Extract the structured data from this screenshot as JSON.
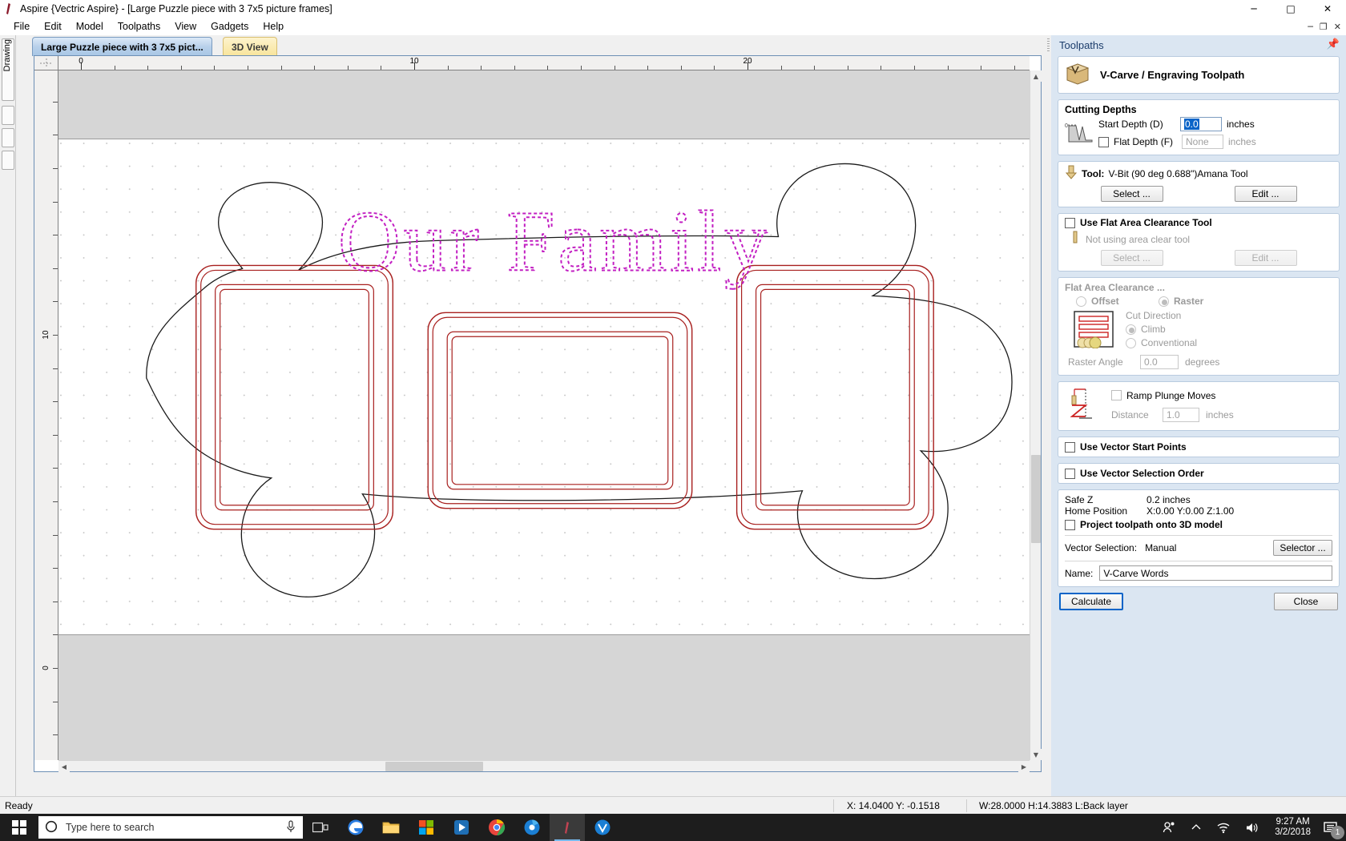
{
  "window": {
    "title": "Aspire {Vectric Aspire} - [Large Puzzle piece with 3 7x5 picture frames]",
    "minimize": "─",
    "maximize": "□",
    "close": "✕",
    "doc_minimize": "─",
    "doc_restore": "❐",
    "doc_close": "✕"
  },
  "menu": {
    "items": [
      "File",
      "Edit",
      "Model",
      "Toolpaths",
      "View",
      "Gadgets",
      "Help"
    ]
  },
  "left_dock": {
    "label": "Drawing"
  },
  "tabs": [
    {
      "label": "Large Puzzle piece with 3 7x5 pict...",
      "active": true
    },
    {
      "label": "3D View",
      "active": false
    }
  ],
  "rulers": {
    "horizontal_labels": [
      "0",
      "10",
      "20"
    ],
    "vertical_labels": [
      "10",
      "0"
    ]
  },
  "canvas": {
    "artwork_text": "Our Family"
  },
  "toolpaths": {
    "panel_title": "Toolpaths",
    "pin_icon": "pin-icon",
    "header": "V-Carve / Engraving Toolpath",
    "cutting_depths": {
      "title": "Cutting Depths",
      "start_depth_label": "Start Depth (D)",
      "start_depth_value": "0.0",
      "start_depth_units": "inches",
      "flat_depth_label": "Flat Depth (F)",
      "flat_depth_checked": false,
      "flat_depth_value": "None",
      "flat_depth_units": "inches"
    },
    "tool": {
      "label": "Tool:",
      "value": "V-Bit (90 deg 0.688\")Amana Tool",
      "select_button": "Select ...",
      "edit_button": "Edit ..."
    },
    "area_clearance_tool": {
      "checkbox_label": "Use Flat Area Clearance Tool",
      "checked": false,
      "status": "Not using area clear tool",
      "select_button": "Select ...",
      "edit_button": "Edit ..."
    },
    "flat_area_clearance": {
      "title": "Flat Area Clearance ...",
      "offset_label": "Offset",
      "raster_label": "Raster",
      "strategy_selected": "Raster",
      "cut_direction_label": "Cut Direction",
      "climb_label": "Climb",
      "conventional_label": "Conventional",
      "cut_direction_selected": "Climb",
      "raster_angle_label": "Raster Angle",
      "raster_angle_value": "0.0",
      "raster_angle_units": "degrees"
    },
    "ramp": {
      "checkbox_label": "Ramp Plunge Moves",
      "checked": false,
      "distance_label": "Distance",
      "distance_value": "1.0",
      "distance_units": "inches"
    },
    "vector_start_points": {
      "label": "Use Vector Start Points",
      "checked": false
    },
    "vector_selection_order": {
      "label": "Use Vector Selection Order",
      "checked": false
    },
    "position": {
      "safe_z_label": "Safe Z",
      "safe_z_value": "0.2 inches",
      "home_position_label": "Home Position",
      "home_position_value": "X:0.00 Y:0.00 Z:1.00",
      "project_label": "Project toolpath onto 3D model",
      "project_checked": false,
      "vector_selection_label": "Vector Selection:",
      "vector_selection_value": "Manual",
      "selector_button": "Selector ...",
      "name_label": "Name:",
      "name_value": "V-Carve Words"
    },
    "calculate_button": "Calculate",
    "close_button": "Close"
  },
  "statusbar": {
    "ready": "Ready",
    "coords": "X: 14.0400 Y: -0.1518",
    "dimensions": "W:28.0000   H:14.3883   L:Back layer"
  },
  "taskbar": {
    "start_icon": "windows-start-icon",
    "search_placeholder": "Type here to search",
    "search_icon": "search-circle-icon",
    "mic_icon": "microphone-icon",
    "items": [
      {
        "name": "task-view-icon"
      },
      {
        "name": "edge-browser-icon"
      },
      {
        "name": "file-explorer-icon"
      },
      {
        "name": "microsoft-store-icon"
      },
      {
        "name": "media-player-icon"
      },
      {
        "name": "chrome-browser-icon"
      },
      {
        "name": "photo-viewer-icon"
      },
      {
        "name": "aspire-app-icon"
      },
      {
        "name": "vcarve-app-icon"
      }
    ],
    "tray": {
      "people_icon": "people-icon",
      "chevron_icon": "chevron-up-icon",
      "wifi_icon": "wifi-icon",
      "volume_icon": "speaker-icon",
      "time": "9:27 AM",
      "date": "3/2/2018",
      "notification_icon": "notification-icon",
      "notification_count": "1"
    }
  },
  "colors": {
    "accent": "#0a64c8",
    "panel_bg": "#dbe6f2",
    "vector_red": "#b22222",
    "vector_selected": "#c21fc2",
    "tab_active": "#b8d0ea",
    "tab_3d": "#f8e49b"
  }
}
